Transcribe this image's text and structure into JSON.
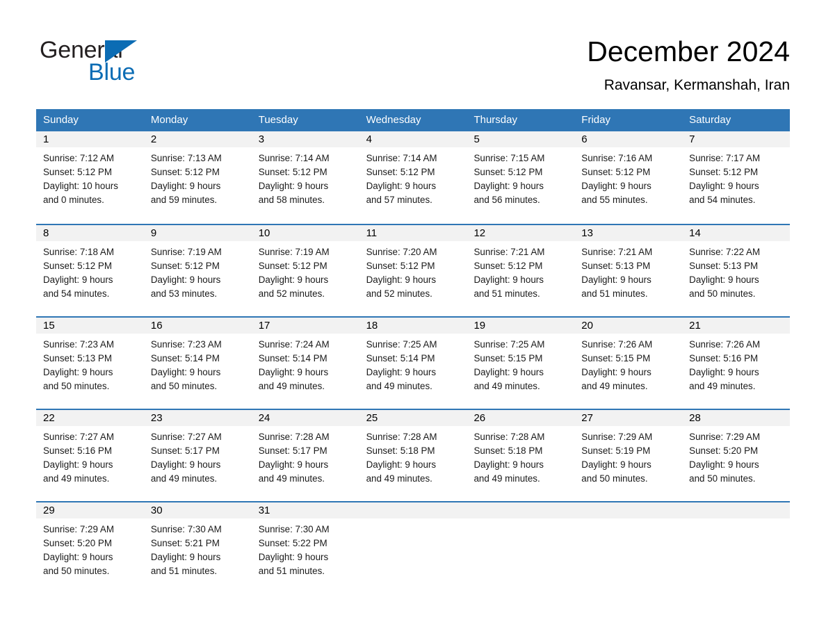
{
  "brand": {
    "name_part1": "General",
    "name_part2": "Blue",
    "accent_color": "#0b6cb4",
    "triangle_icon": "triangle-icon"
  },
  "header": {
    "title": "December 2024",
    "subtitle": "Ravansar, Kermanshah, Iran"
  },
  "calendar": {
    "header_bg": "#2f76b5",
    "day_band_bg": "#f2f2f2",
    "weekdays": [
      "Sunday",
      "Monday",
      "Tuesday",
      "Wednesday",
      "Thursday",
      "Friday",
      "Saturday"
    ],
    "weeks": [
      {
        "days": [
          {
            "num": "1",
            "sunrise": "Sunrise: 7:12 AM",
            "sunset": "Sunset: 5:12 PM",
            "daylight1": "Daylight: 10 hours",
            "daylight2": "and 0 minutes."
          },
          {
            "num": "2",
            "sunrise": "Sunrise: 7:13 AM",
            "sunset": "Sunset: 5:12 PM",
            "daylight1": "Daylight: 9 hours",
            "daylight2": "and 59 minutes."
          },
          {
            "num": "3",
            "sunrise": "Sunrise: 7:14 AM",
            "sunset": "Sunset: 5:12 PM",
            "daylight1": "Daylight: 9 hours",
            "daylight2": "and 58 minutes."
          },
          {
            "num": "4",
            "sunrise": "Sunrise: 7:14 AM",
            "sunset": "Sunset: 5:12 PM",
            "daylight1": "Daylight: 9 hours",
            "daylight2": "and 57 minutes."
          },
          {
            "num": "5",
            "sunrise": "Sunrise: 7:15 AM",
            "sunset": "Sunset: 5:12 PM",
            "daylight1": "Daylight: 9 hours",
            "daylight2": "and 56 minutes."
          },
          {
            "num": "6",
            "sunrise": "Sunrise: 7:16 AM",
            "sunset": "Sunset: 5:12 PM",
            "daylight1": "Daylight: 9 hours",
            "daylight2": "and 55 minutes."
          },
          {
            "num": "7",
            "sunrise": "Sunrise: 7:17 AM",
            "sunset": "Sunset: 5:12 PM",
            "daylight1": "Daylight: 9 hours",
            "daylight2": "and 54 minutes."
          }
        ]
      },
      {
        "days": [
          {
            "num": "8",
            "sunrise": "Sunrise: 7:18 AM",
            "sunset": "Sunset: 5:12 PM",
            "daylight1": "Daylight: 9 hours",
            "daylight2": "and 54 minutes."
          },
          {
            "num": "9",
            "sunrise": "Sunrise: 7:19 AM",
            "sunset": "Sunset: 5:12 PM",
            "daylight1": "Daylight: 9 hours",
            "daylight2": "and 53 minutes."
          },
          {
            "num": "10",
            "sunrise": "Sunrise: 7:19 AM",
            "sunset": "Sunset: 5:12 PM",
            "daylight1": "Daylight: 9 hours",
            "daylight2": "and 52 minutes."
          },
          {
            "num": "11",
            "sunrise": "Sunrise: 7:20 AM",
            "sunset": "Sunset: 5:12 PM",
            "daylight1": "Daylight: 9 hours",
            "daylight2": "and 52 minutes."
          },
          {
            "num": "12",
            "sunrise": "Sunrise: 7:21 AM",
            "sunset": "Sunset: 5:12 PM",
            "daylight1": "Daylight: 9 hours",
            "daylight2": "and 51 minutes."
          },
          {
            "num": "13",
            "sunrise": "Sunrise: 7:21 AM",
            "sunset": "Sunset: 5:13 PM",
            "daylight1": "Daylight: 9 hours",
            "daylight2": "and 51 minutes."
          },
          {
            "num": "14",
            "sunrise": "Sunrise: 7:22 AM",
            "sunset": "Sunset: 5:13 PM",
            "daylight1": "Daylight: 9 hours",
            "daylight2": "and 50 minutes."
          }
        ]
      },
      {
        "days": [
          {
            "num": "15",
            "sunrise": "Sunrise: 7:23 AM",
            "sunset": "Sunset: 5:13 PM",
            "daylight1": "Daylight: 9 hours",
            "daylight2": "and 50 minutes."
          },
          {
            "num": "16",
            "sunrise": "Sunrise: 7:23 AM",
            "sunset": "Sunset: 5:14 PM",
            "daylight1": "Daylight: 9 hours",
            "daylight2": "and 50 minutes."
          },
          {
            "num": "17",
            "sunrise": "Sunrise: 7:24 AM",
            "sunset": "Sunset: 5:14 PM",
            "daylight1": "Daylight: 9 hours",
            "daylight2": "and 49 minutes."
          },
          {
            "num": "18",
            "sunrise": "Sunrise: 7:25 AM",
            "sunset": "Sunset: 5:14 PM",
            "daylight1": "Daylight: 9 hours",
            "daylight2": "and 49 minutes."
          },
          {
            "num": "19",
            "sunrise": "Sunrise: 7:25 AM",
            "sunset": "Sunset: 5:15 PM",
            "daylight1": "Daylight: 9 hours",
            "daylight2": "and 49 minutes."
          },
          {
            "num": "20",
            "sunrise": "Sunrise: 7:26 AM",
            "sunset": "Sunset: 5:15 PM",
            "daylight1": "Daylight: 9 hours",
            "daylight2": "and 49 minutes."
          },
          {
            "num": "21",
            "sunrise": "Sunrise: 7:26 AM",
            "sunset": "Sunset: 5:16 PM",
            "daylight1": "Daylight: 9 hours",
            "daylight2": "and 49 minutes."
          }
        ]
      },
      {
        "days": [
          {
            "num": "22",
            "sunrise": "Sunrise: 7:27 AM",
            "sunset": "Sunset: 5:16 PM",
            "daylight1": "Daylight: 9 hours",
            "daylight2": "and 49 minutes."
          },
          {
            "num": "23",
            "sunrise": "Sunrise: 7:27 AM",
            "sunset": "Sunset: 5:17 PM",
            "daylight1": "Daylight: 9 hours",
            "daylight2": "and 49 minutes."
          },
          {
            "num": "24",
            "sunrise": "Sunrise: 7:28 AM",
            "sunset": "Sunset: 5:17 PM",
            "daylight1": "Daylight: 9 hours",
            "daylight2": "and 49 minutes."
          },
          {
            "num": "25",
            "sunrise": "Sunrise: 7:28 AM",
            "sunset": "Sunset: 5:18 PM",
            "daylight1": "Daylight: 9 hours",
            "daylight2": "and 49 minutes."
          },
          {
            "num": "26",
            "sunrise": "Sunrise: 7:28 AM",
            "sunset": "Sunset: 5:18 PM",
            "daylight1": "Daylight: 9 hours",
            "daylight2": "and 49 minutes."
          },
          {
            "num": "27",
            "sunrise": "Sunrise: 7:29 AM",
            "sunset": "Sunset: 5:19 PM",
            "daylight1": "Daylight: 9 hours",
            "daylight2": "and 50 minutes."
          },
          {
            "num": "28",
            "sunrise": "Sunrise: 7:29 AM",
            "sunset": "Sunset: 5:20 PM",
            "daylight1": "Daylight: 9 hours",
            "daylight2": "and 50 minutes."
          }
        ]
      },
      {
        "days": [
          {
            "num": "29",
            "sunrise": "Sunrise: 7:29 AM",
            "sunset": "Sunset: 5:20 PM",
            "daylight1": "Daylight: 9 hours",
            "daylight2": "and 50 minutes."
          },
          {
            "num": "30",
            "sunrise": "Sunrise: 7:30 AM",
            "sunset": "Sunset: 5:21 PM",
            "daylight1": "Daylight: 9 hours",
            "daylight2": "and 51 minutes."
          },
          {
            "num": "31",
            "sunrise": "Sunrise: 7:30 AM",
            "sunset": "Sunset: 5:22 PM",
            "daylight1": "Daylight: 9 hours",
            "daylight2": "and 51 minutes."
          },
          {
            "num": "",
            "sunrise": "",
            "sunset": "",
            "daylight1": "",
            "daylight2": ""
          },
          {
            "num": "",
            "sunrise": "",
            "sunset": "",
            "daylight1": "",
            "daylight2": ""
          },
          {
            "num": "",
            "sunrise": "",
            "sunset": "",
            "daylight1": "",
            "daylight2": ""
          },
          {
            "num": "",
            "sunrise": "",
            "sunset": "",
            "daylight1": "",
            "daylight2": ""
          }
        ]
      }
    ]
  }
}
